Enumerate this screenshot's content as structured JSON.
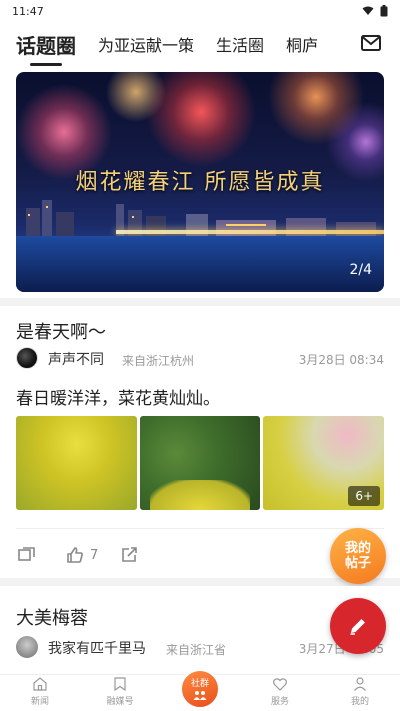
{
  "status": {
    "time": "11:47"
  },
  "tabs": [
    {
      "label": "话题圈",
      "active": true
    },
    {
      "label": "为亚运献一策",
      "active": false
    },
    {
      "label": "生活圈",
      "active": false
    },
    {
      "label": "桐庐",
      "active": false
    }
  ],
  "banner": {
    "title": "烟花耀春江 所愿皆成真",
    "counter": "2/4"
  },
  "posts": [
    {
      "title": "是春天啊～",
      "author": "声声不同",
      "from": "来自浙江杭州",
      "time": "3月28日 08:34",
      "body": "春日暖洋洋，菜花黄灿灿。",
      "more_photos": "6+",
      "likes": "7"
    },
    {
      "title": "大美梅蓉",
      "author": "我家有匹千里马",
      "from": "来自浙江省",
      "time": "3月27日 13:05"
    }
  ],
  "fab_post_label": "我的帖子",
  "bottom_nav": [
    {
      "label": "新闻",
      "icon": "home-icon"
    },
    {
      "label": "融媒号",
      "icon": "bookmark-icon"
    },
    {
      "label": "社群",
      "icon": "community-icon"
    },
    {
      "label": "服务",
      "icon": "heart-icon"
    },
    {
      "label": "我的",
      "icon": "person-icon"
    }
  ],
  "colors": {
    "accent_red": "#d8262d",
    "accent_orange": "#f47a1f"
  }
}
